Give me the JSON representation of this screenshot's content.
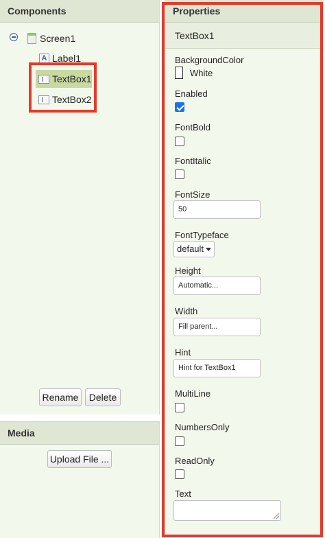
{
  "components": {
    "header": "Components",
    "tree": [
      {
        "label": "Screen1"
      },
      {
        "label": "Label1"
      },
      {
        "label": "TextBox1"
      },
      {
        "label": "TextBox2"
      }
    ],
    "rename_label": "Rename",
    "delete_label": "Delete"
  },
  "media": {
    "header": "Media",
    "upload_label": "Upload File ..."
  },
  "properties": {
    "header": "Properties",
    "component_name": "TextBox1",
    "background_color": {
      "label": "BackgroundColor",
      "value": "White"
    },
    "enabled": {
      "label": "Enabled"
    },
    "font_bold": {
      "label": "FontBold"
    },
    "font_italic": {
      "label": "FontItalic"
    },
    "font_size": {
      "label": "FontSize",
      "value": "50"
    },
    "font_typeface": {
      "label": "FontTypeface",
      "value": "default"
    },
    "height": {
      "label": "Height",
      "value": "Automatic..."
    },
    "width": {
      "label": "Width",
      "value": "Fill parent..."
    },
    "hint": {
      "label": "Hint",
      "value": "Hint for TextBox1"
    },
    "multiline": {
      "label": "MultiLine"
    },
    "numbers_only": {
      "label": "NumbersOnly"
    },
    "read_only": {
      "label": "ReadOnly"
    },
    "text": {
      "label": "Text",
      "value": ""
    }
  },
  "colors": {
    "highlight": "#e23b2b",
    "panel_bg": "#f3f8ec",
    "header_bg": "#dfe6d4",
    "selected": "#c8d9a2",
    "checkbox": "#1a73e8"
  }
}
